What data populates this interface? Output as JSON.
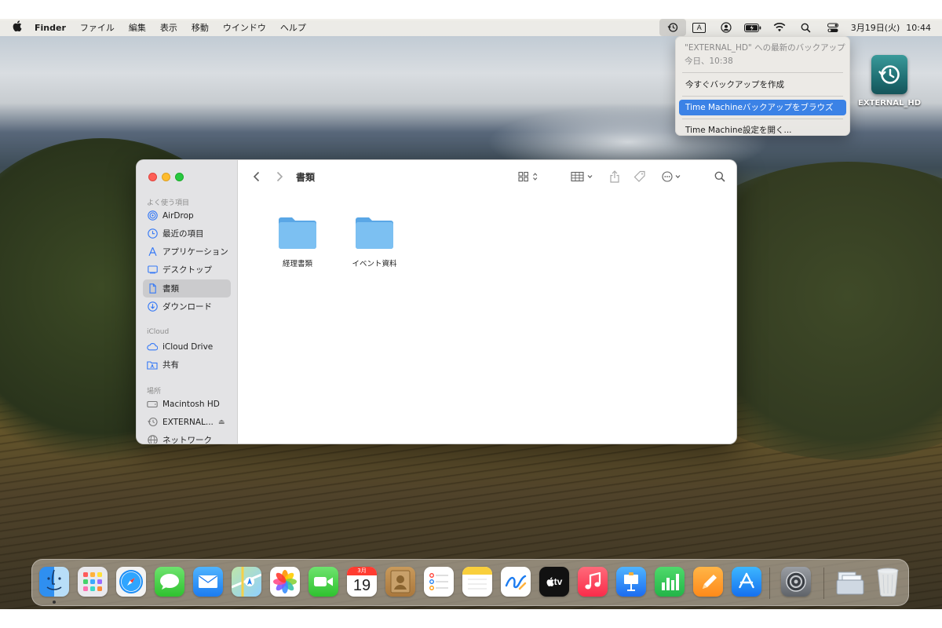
{
  "menubar": {
    "app_name": "Finder",
    "items": [
      "ファイル",
      "編集",
      "表示",
      "移動",
      "ウインドウ",
      "ヘルプ"
    ],
    "input_mode": "A",
    "date": "3月19日(火)",
    "time": "10:44"
  },
  "tm_menu": {
    "header": "\"EXTERNAL_HD\" への最新のバックアップ",
    "subheader": "今日、10:38",
    "items": [
      "今すぐバックアップを作成",
      "Time Machineバックアップをブラウズ",
      "Time Machine設定を開く..."
    ],
    "highlighted_index": 1
  },
  "desktop": {
    "drive_label": "EXTERNAL_HD"
  },
  "finder": {
    "title": "書類",
    "sidebar": {
      "favorites_header": "よく使う項目",
      "favorites": [
        "AirDrop",
        "最近の項目",
        "アプリケーション",
        "デスクトップ",
        "書類",
        "ダウンロード"
      ],
      "selected": "書類",
      "icloud_header": "iCloud",
      "icloud": [
        "iCloud Drive",
        "共有"
      ],
      "locations_header": "場所",
      "locations": [
        "Macintosh HD",
        "EXTERNAL...",
        "ネットワーク"
      ]
    },
    "folders": [
      "経理書類",
      "イベント資料"
    ]
  },
  "dock": {
    "calendar_month": "3月",
    "calendar_day": "19",
    "tv_label": "tv"
  },
  "colors": {
    "accent": "#3b82e6",
    "folder": "#6fb6ef",
    "traffic_red": "#fe5f57",
    "traffic_yellow": "#febc2e",
    "traffic_green": "#28c840"
  }
}
